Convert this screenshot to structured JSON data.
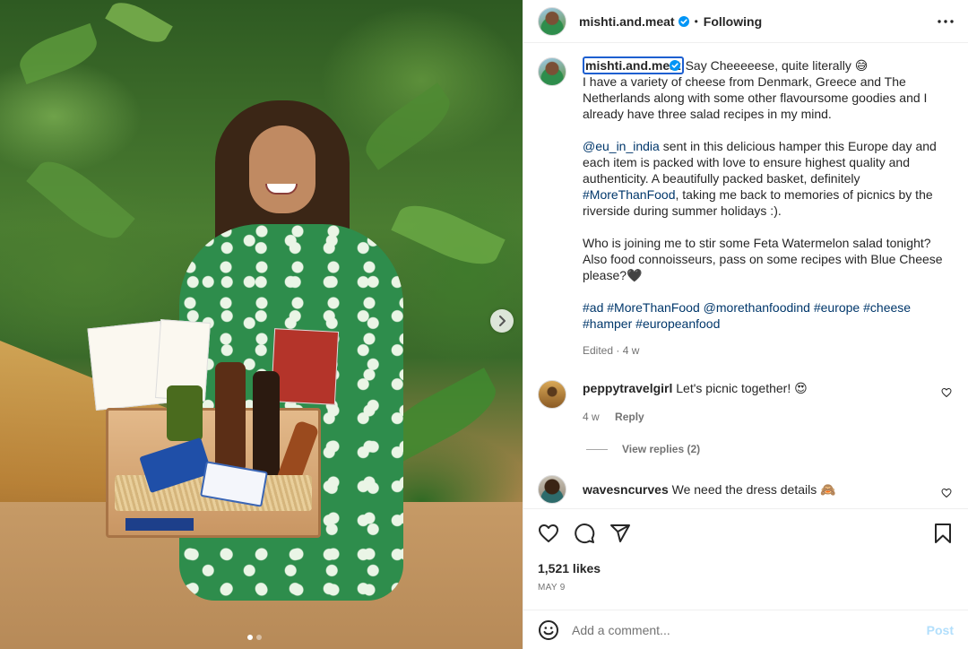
{
  "post": {
    "username": "mishti.and.meat",
    "dot": "•",
    "follow_status": "Following",
    "more": "•••",
    "verified_icon": "verified-badge-icon",
    "accent_color": "#0095f6"
  },
  "caption": {
    "username": "mishti.and.meat",
    "line1": "Say Cheeeeese, quite literally 😅",
    "para1": "I have a variety of cheese from Denmark, Greece and The Netherlands along with some other flavoursome goodies and I already have three salad recipes in my mind.",
    "mention1": "@eu_in_india",
    "para2a": " sent in this delicious hamper this Europe day and each item is packed with love to ensure highest quality and authenticity. A beautifully packed basket, definitely ",
    "hashtag1": "#MoreThanFood",
    "para2b": ", taking me back to memories of picnics by the riverside during summer holidays :).",
    "para3": "Who is joining me to stir some Feta Watermelon salad tonight? Also food connoisseurs, pass on some recipes with Blue Cheese please?🖤",
    "tags": [
      "#ad",
      "#MoreThanFood",
      "@morethanfoodind",
      "#europe",
      "#cheese",
      "#hamper",
      "#europeanfood"
    ],
    "meta": "Edited · 4 w"
  },
  "comments": [
    {
      "user": "peppytravelgirl",
      "text": "Let's picnic together! 😍",
      "time": "4 w",
      "reply": "Reply",
      "view_replies": "View replies (2)"
    },
    {
      "user": "wavesncurves",
      "text": "We need the dress details 🙈"
    }
  ],
  "stats": {
    "likes": "1,521 likes",
    "date": "MAY 9"
  },
  "composer": {
    "placeholder": "Add a comment...",
    "post_label": "Post"
  },
  "carousel": {
    "slide_count": 2,
    "active_index": 0
  }
}
